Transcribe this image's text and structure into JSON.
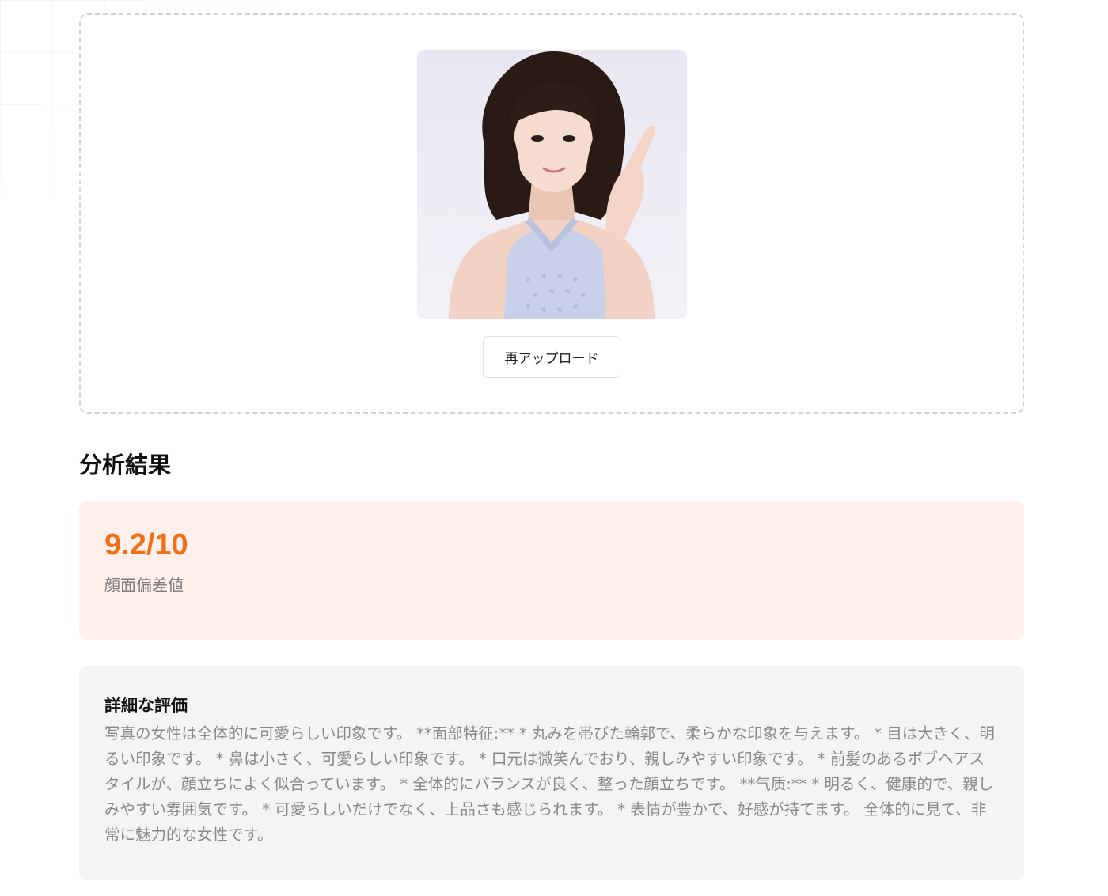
{
  "upload": {
    "photo_alt": "uploaded portrait photo",
    "reupload_label": "再アップロード"
  },
  "results": {
    "section_title": "分析結果",
    "score_value": "9.2/10",
    "score_label": "顔面偏差値"
  },
  "detail": {
    "title": "詳細な評価",
    "text": "写真の女性は全体的に可愛らしい印象です。 **面部特征:** * 丸みを帯びた輪郭で、柔らかな印象を与えます。 * 目は大きく、明るい印象です。 * 鼻は小さく、可愛らしい印象です。 * 口元は微笑んでおり、親しみやすい印象です。 * 前髪のあるボブヘアスタイルが、顔立ちによく似合っています。 * 全体的にバランスが良く、整った顔立ちです。 **气质:** * 明るく、健康的で、親しみやすい雰囲気です。 * 可愛らしいだけでなく、上品さも感じられます。 * 表情が豊かで、好感が持てます。 全体的に見て、非常に魅力的な女性です。"
  },
  "colors": {
    "accent": "#f07018",
    "score_bg": "#fff0eb",
    "detail_bg": "#f4f4f2"
  }
}
